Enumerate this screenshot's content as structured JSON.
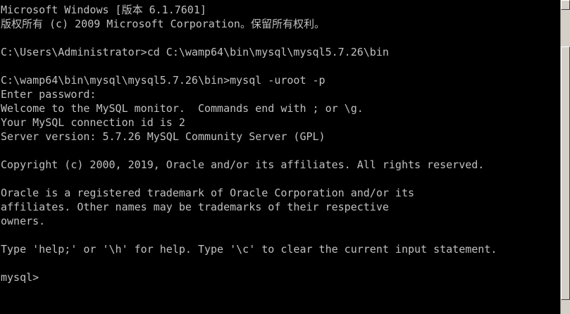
{
  "console": {
    "lines": [
      "Microsoft Windows [版本 6.1.7601]",
      "版权所有 (c) 2009 Microsoft Corporation。保留所有权利。",
      "",
      "C:\\Users\\Administrator>cd C:\\wamp64\\bin\\mysql\\mysql5.7.26\\bin",
      "",
      "C:\\wamp64\\bin\\mysql\\mysql5.7.26\\bin>mysql -uroot -p",
      "Enter password:",
      "Welcome to the MySQL monitor.  Commands end with ; or \\g.",
      "Your MySQL connection id is 2",
      "Server version: 5.7.26 MySQL Community Server (GPL)",
      "",
      "Copyright (c) 2000, 2019, Oracle and/or its affiliates. All rights reserved.",
      "",
      "Oracle is a registered trademark of Oracle Corporation and/or its",
      "affiliates. Other names may be trademarks of their respective",
      "owners.",
      "",
      "Type 'help;' or '\\h' for help. Type '\\c' to clear the current input statement.",
      "",
      "mysql>"
    ]
  },
  "colors": {
    "background": "#000000",
    "text": "#c0c0c0",
    "scrollbar": "#d4d0c8"
  }
}
